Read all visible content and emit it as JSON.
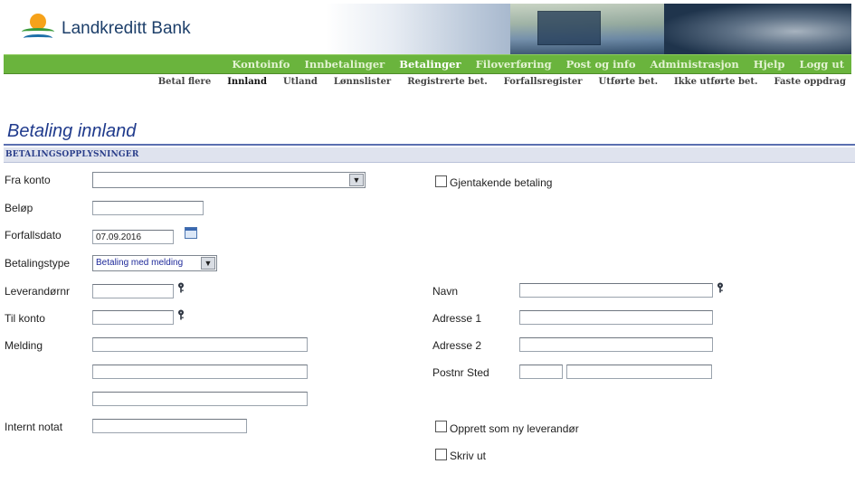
{
  "brand": {
    "name": "Landkreditt Bank"
  },
  "main_nav": [
    {
      "label": "Kontoinfo",
      "active": false
    },
    {
      "label": "Innbetalinger",
      "active": false
    },
    {
      "label": "Betalinger",
      "active": true
    },
    {
      "label": "Filoverføring",
      "active": false
    },
    {
      "label": "Post og info",
      "active": false
    },
    {
      "label": "Administrasjon",
      "active": false
    },
    {
      "label": "Hjelp",
      "active": false
    },
    {
      "label": "Logg ut",
      "active": false
    }
  ],
  "sub_nav": [
    {
      "label": "Betal flere",
      "active": false
    },
    {
      "label": "Innland",
      "active": true
    },
    {
      "label": "Utland",
      "active": false
    },
    {
      "label": "Lønnslister",
      "active": false
    },
    {
      "label": "Registrerte bet.",
      "active": false
    },
    {
      "label": "Forfallsregister",
      "active": false
    },
    {
      "label": "Utførte bet.",
      "active": false
    },
    {
      "label": "Ikke utførte bet.",
      "active": false
    },
    {
      "label": "Faste oppdrag",
      "active": false
    }
  ],
  "page": {
    "title": "Betaling innland",
    "section": "BETALINGSOPPLYSNINGER"
  },
  "form": {
    "fra_konto": {
      "label": "Fra konto",
      "value": ""
    },
    "belop": {
      "label": "Beløp",
      "value": ""
    },
    "forfallsdato": {
      "label": "Forfallsdato",
      "value": "07.09.2016"
    },
    "betalingstype": {
      "label": "Betalingstype",
      "value": "Betaling med melding"
    },
    "leverandornr": {
      "label": "Leverandørnr",
      "value": ""
    },
    "til_konto": {
      "label": "Til konto",
      "value": ""
    },
    "melding": {
      "label": "Melding",
      "lines": [
        "",
        "",
        ""
      ]
    },
    "internt_notat": {
      "label": "Internt notat",
      "value": ""
    },
    "gjentakende": {
      "label": "Gjentakende betaling",
      "checked": false
    },
    "navn": {
      "label": "Navn",
      "value": ""
    },
    "adresse1": {
      "label": "Adresse 1",
      "value": ""
    },
    "adresse2": {
      "label": "Adresse 2",
      "value": ""
    },
    "postnr_sted": {
      "label": "Postnr Sted",
      "postnr": "",
      "sted": ""
    },
    "opprett_leverandor": {
      "label": "Opprett som ny leverandør",
      "checked": false
    },
    "skriv_ut": {
      "label": "Skriv ut",
      "checked": false
    }
  },
  "icons": {
    "lookup": "key-icon",
    "calendar": "calendar-icon",
    "dropdown": "chevron-down-icon"
  },
  "colors": {
    "nav_green": "#6ab43d",
    "title_blue": "#1f3a8c",
    "section_bg": "#dfe3ee"
  }
}
